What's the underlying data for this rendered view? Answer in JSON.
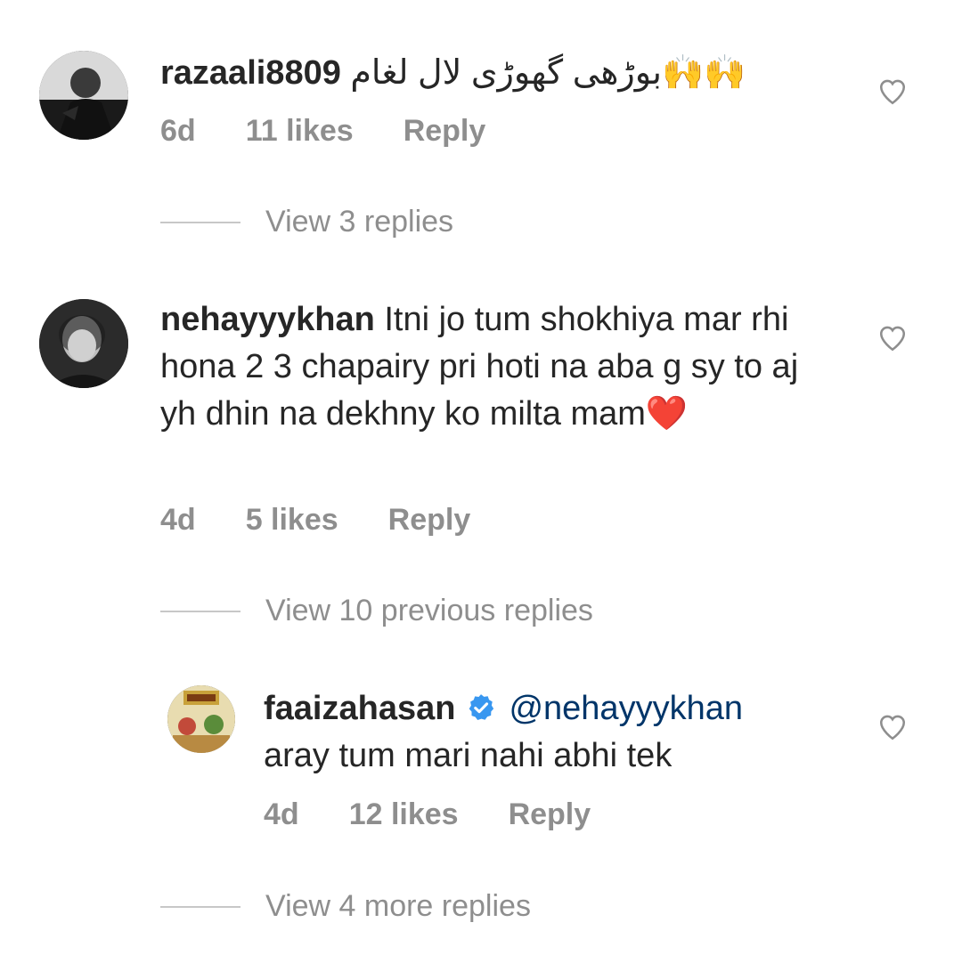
{
  "comments": [
    {
      "username": "razaali8809",
      "text": "بوڑھی گھوڑی لال لغام🙌🙌",
      "time": "6d",
      "likes": "11 likes",
      "reply": "Reply",
      "view_replies": "View 3 replies"
    },
    {
      "username": "nehayyykhan",
      "text": "Itni jo tum shokhiya mar rhi hona 2 3 chapairy pri hoti na aba g sy to aj yh dhin na dekhny ko milta mam❤️",
      "time": "4d",
      "likes": "5 likes",
      "reply": "Reply",
      "view_replies": "View 10 previous replies"
    }
  ],
  "reply": {
    "username": "faaizahasan",
    "verified": true,
    "mention": "@nehayyykhan",
    "text": "aray tum mari nahi abhi tek",
    "time": "4d",
    "likes": "12 likes",
    "reply": "Reply",
    "view_replies": "View 4 more replies"
  },
  "colors": {
    "text": "#262626",
    "meta": "#8e8e8e",
    "mention": "#003569",
    "verified": "#3897f0"
  }
}
